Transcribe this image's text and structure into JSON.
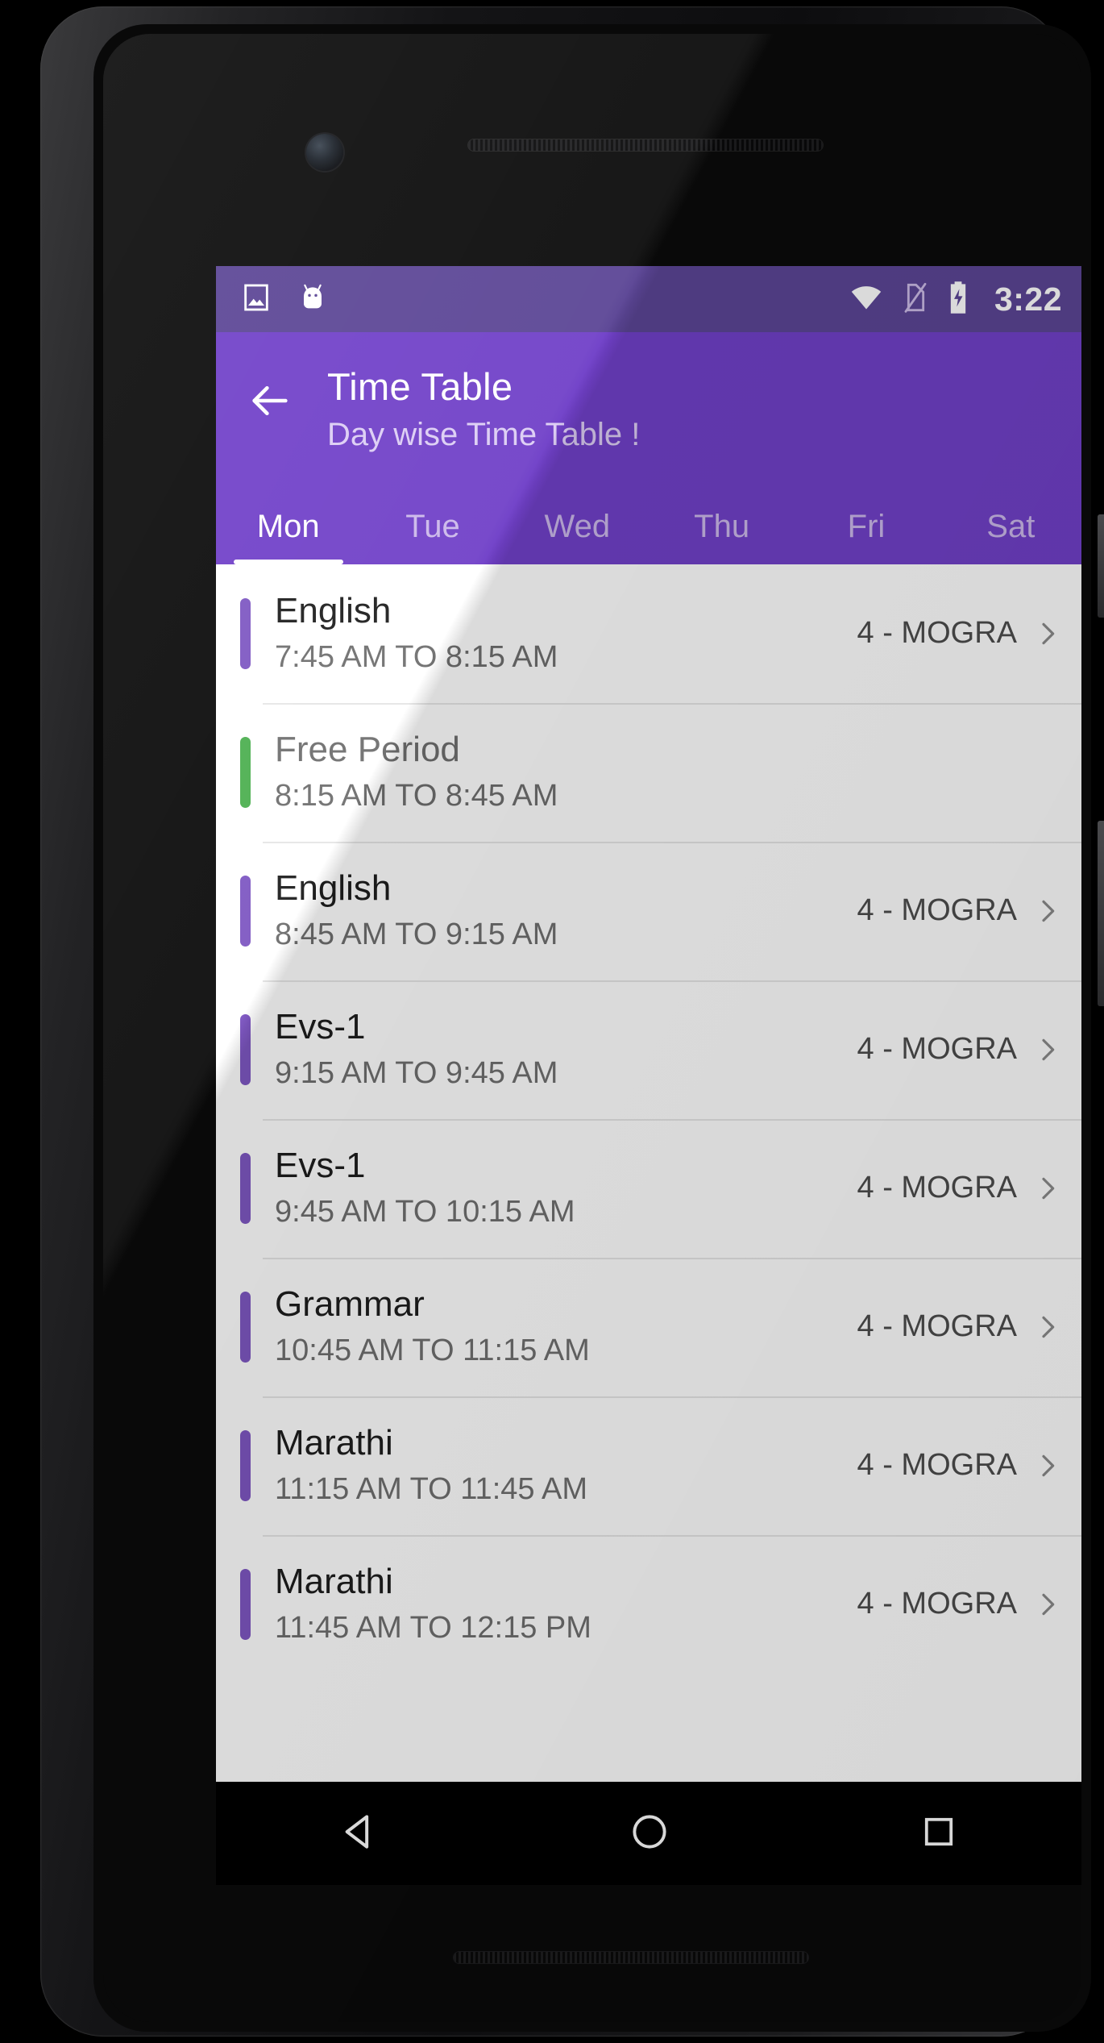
{
  "status_bar": {
    "time": "3:22",
    "left_icons": [
      "image-icon",
      "android-bot-icon"
    ],
    "right_icons": [
      "wifi-icon",
      "sim-off-icon",
      "battery-charging-icon"
    ],
    "background": "#5b4595"
  },
  "app_bar": {
    "back_icon": "back-arrow-icon",
    "title": "Time Table",
    "subtitle": "Day wise Time Table !",
    "background": "#7040c8"
  },
  "tabs": {
    "active_index": 0,
    "items": [
      {
        "label": "Mon"
      },
      {
        "label": "Tue"
      },
      {
        "label": "Wed"
      },
      {
        "label": "Thu"
      },
      {
        "label": "Fri"
      },
      {
        "label": "Sat"
      }
    ]
  },
  "periods": [
    {
      "subject": "English",
      "time": "7:45 AM TO 8:15 AM",
      "class": "4 - MOGRA",
      "accent": "#7e57c2",
      "free": false
    },
    {
      "subject": "Free Period",
      "time": "8:15 AM TO 8:45 AM",
      "class": "",
      "accent": "#4caf50",
      "free": true
    },
    {
      "subject": "English",
      "time": "8:45 AM TO 9:15 AM",
      "class": "4 - MOGRA",
      "accent": "#7e57c2",
      "free": false
    },
    {
      "subject": "Evs-1",
      "time": "9:15 AM TO 9:45 AM",
      "class": "4 - MOGRA",
      "accent": "#7e57c2",
      "free": false
    },
    {
      "subject": "Evs-1",
      "time": "9:45 AM TO 10:15 AM",
      "class": "4 - MOGRA",
      "accent": "#7e57c2",
      "free": false
    },
    {
      "subject": "Grammar",
      "time": "10:45 AM TO 11:15 AM",
      "class": "4 - MOGRA",
      "accent": "#7e57c2",
      "free": false
    },
    {
      "subject": "Marathi",
      "time": "11:15 AM TO 11:45 AM",
      "class": "4 - MOGRA",
      "accent": "#7e57c2",
      "free": false
    },
    {
      "subject": "Marathi",
      "time": "11:45 AM TO 12:15 PM",
      "class": "4 - MOGRA",
      "accent": "#7e57c2",
      "free": false
    }
  ],
  "nav_bar": {
    "back": "nav-back-triangle-icon",
    "home": "nav-home-circle-icon",
    "recents": "nav-recents-square-icon"
  }
}
